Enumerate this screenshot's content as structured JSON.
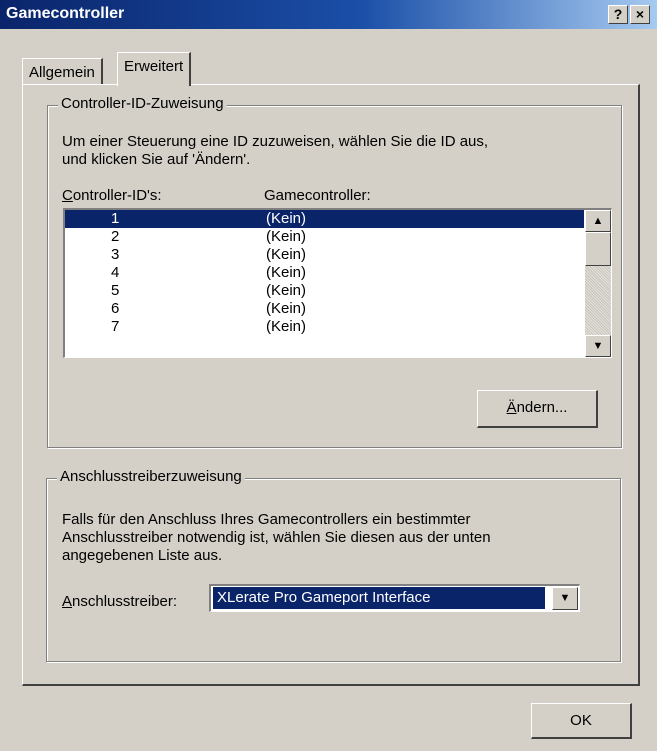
{
  "window": {
    "title": "Gamecontroller",
    "help_label": "?",
    "close_label": "×"
  },
  "tabs": [
    {
      "label": "Allgemein"
    },
    {
      "label": "Erweitert"
    }
  ],
  "id_group": {
    "legend": "Controller-ID-Zuweisung",
    "description_line1": "Um einer Steuerung eine ID zuzuweisen, wählen Sie die ID aus,",
    "description_line2": "und klicken Sie auf 'Ändern'.",
    "col_ids": "Controller-ID's:",
    "col_ids_mnemonic": "C",
    "col_ids_rest": "ontroller-ID's:",
    "col_controller": "Gamecontroller:",
    "rows": [
      {
        "id": "1",
        "controller": "(Kein)"
      },
      {
        "id": "2",
        "controller": "(Kein)"
      },
      {
        "id": "3",
        "controller": "(Kein)"
      },
      {
        "id": "4",
        "controller": "(Kein)"
      },
      {
        "id": "5",
        "controller": "(Kein)"
      },
      {
        "id": "6",
        "controller": "(Kein)"
      },
      {
        "id": "7",
        "controller": "(Kein)"
      }
    ],
    "selected_row": 0,
    "change_button": "Ändern...",
    "change_button_mnemonic": "Ä",
    "change_button_rest": "ndern..."
  },
  "driver_group": {
    "legend": "Anschlusstreiberzuweisung",
    "description_line1": "Falls für den Anschluss Ihres Gamecontrollers ein bestimmter",
    "description_line2": "Anschlusstreiber notwendig ist, wählen Sie diesen aus der unten",
    "description_line3": "angegebenen Liste aus.",
    "driver_label": "Anschlusstreiber:",
    "driver_label_mnemonic": "A",
    "driver_label_rest": "nschlusstreiber:",
    "driver_value": "XLerate Pro Gameport Interface"
  },
  "ok_button": "OK",
  "colors": {
    "titlebar": "#0a246a",
    "selection": "#0a246a",
    "face": "#d4d0c8"
  },
  "icons": {
    "scroll_up": "triangle-up-icon",
    "scroll_down": "triangle-down-icon",
    "dropdown": "triangle-down-icon"
  }
}
